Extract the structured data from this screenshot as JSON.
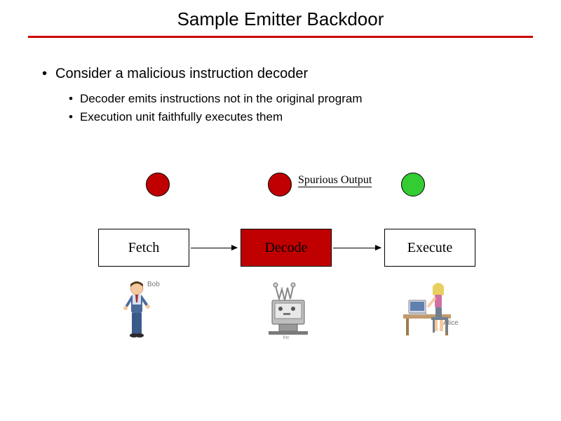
{
  "title": "Sample Emitter Backdoor",
  "bullets": {
    "l1": "Consider a malicious instruction decoder",
    "l2a": "Decoder emits instructions not in the original program",
    "l2b": "Execution unit faithfully executes them"
  },
  "diagram": {
    "spurious_label": "Spurious Output",
    "boxes": {
      "fetch": "Fetch",
      "decode": "Decode",
      "execute": "Execute"
    },
    "figures": {
      "bob_label": "Bob",
      "alice_label": "Alice"
    }
  },
  "colors": {
    "red_box": "#c00000",
    "green_circle": "#33cc33",
    "red_circle": "#c00000",
    "underline": "#cc0000"
  }
}
